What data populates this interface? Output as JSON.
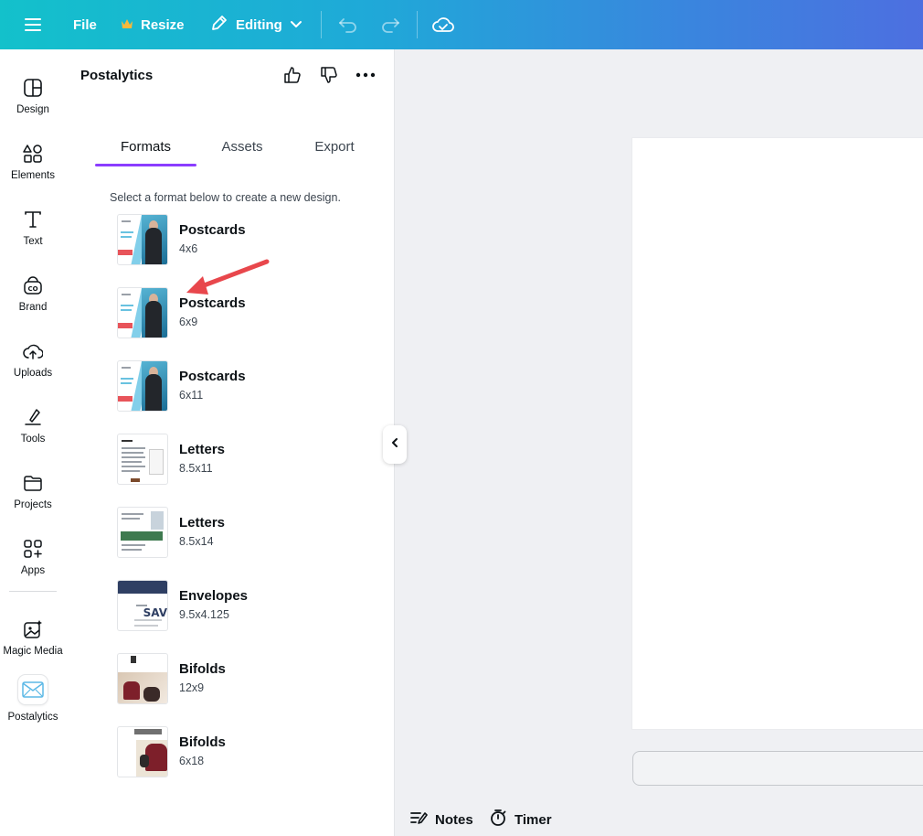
{
  "topbar": {
    "file_label": "File",
    "resize_label": "Resize",
    "editing_label": "Editing",
    "icons": [
      "menu-icon",
      "crown-icon",
      "pencil-icon",
      "chevron-down-icon",
      "undo-icon",
      "redo-icon",
      "cloud-check-icon"
    ]
  },
  "rail": {
    "items": [
      {
        "label": "Design",
        "icon": "layout-icon"
      },
      {
        "label": "Elements",
        "icon": "shapes-icon"
      },
      {
        "label": "Text",
        "icon": "text-icon"
      },
      {
        "label": "Brand",
        "icon": "brand-icon"
      },
      {
        "label": "Uploads",
        "icon": "cloud-upload-icon"
      },
      {
        "label": "Tools",
        "icon": "draw-tool-icon"
      },
      {
        "label": "Projects",
        "icon": "folder-icon"
      },
      {
        "label": "Apps",
        "icon": "apps-grid-icon"
      },
      {
        "label": "Magic Media",
        "icon": "magic-image-icon"
      },
      {
        "label": "Postalytics",
        "icon": "envelope-icon"
      }
    ]
  },
  "panel": {
    "title": "Postalytics",
    "tabs": [
      {
        "label": "Formats",
        "active": true
      },
      {
        "label": "Assets",
        "active": false
      },
      {
        "label": "Export",
        "active": false
      }
    ],
    "instructions": "Select a format below to create a new design.",
    "formats": [
      {
        "name": "Postcards",
        "size": "4x6",
        "thumb": "postcard"
      },
      {
        "name": "Postcards",
        "size": "6x9",
        "thumb": "postcard"
      },
      {
        "name": "Postcards",
        "size": "6x11",
        "thumb": "postcard"
      },
      {
        "name": "Letters",
        "size": "8.5x11",
        "thumb": "letter"
      },
      {
        "name": "Letters",
        "size": "8.5x14",
        "thumb": "letter2"
      },
      {
        "name": "Envelopes",
        "size": "9.5x4.125",
        "thumb": "envelope"
      },
      {
        "name": "Bifolds",
        "size": "12x9",
        "thumb": "bifold"
      },
      {
        "name": "Bifolds",
        "size": "6x18",
        "thumb": "bifold2"
      }
    ]
  },
  "bottom": {
    "notes_label": "Notes",
    "timer_label": "Timer"
  },
  "colors": {
    "tab_accent": "#8b3dff",
    "annotation_arrow": "#e8474c"
  }
}
